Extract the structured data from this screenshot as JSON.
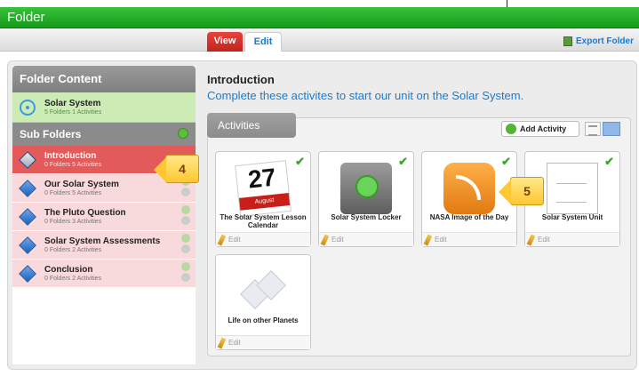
{
  "window": {
    "title": "Folder"
  },
  "tabs": [
    {
      "label": "View"
    },
    {
      "label": "Edit"
    }
  ],
  "export": {
    "label": "Export Folder"
  },
  "sidebar": {
    "header": "Folder Content",
    "root": {
      "title": "Solar System",
      "subtitle": "5 Folders 1 Activities"
    },
    "sub_header": "Sub Folders",
    "items": [
      {
        "title": "Introduction",
        "subtitle": "0 Folders 5 Activities"
      },
      {
        "title": "Our Solar System",
        "subtitle": "0 Folders 5 Activities"
      },
      {
        "title": "The Pluto Question",
        "subtitle": "0 Folders 3 Activities"
      },
      {
        "title": "Solar System Assessments",
        "subtitle": "0 Folders 2 Activities"
      },
      {
        "title": "Conclusion",
        "subtitle": "0 Folders 2 Activities"
      }
    ]
  },
  "callouts": {
    "a": "4",
    "b": "5"
  },
  "main": {
    "title": "Introduction",
    "description": "Complete these activites to start our unit on the Solar System.",
    "activities_tab": "Activities",
    "add_label": "Add Activity",
    "cards": [
      {
        "label": "The Solar System Lesson Calendar",
        "edit": "Edit",
        "icon": "calendar-icon",
        "cal_day": "27",
        "cal_month": "August"
      },
      {
        "label": "Solar System Locker",
        "edit": "Edit",
        "icon": "locker-icon"
      },
      {
        "label": "NASA Image of the Day",
        "edit": "Edit",
        "icon": "rss-icon"
      },
      {
        "label": "Solar System Unit",
        "edit": "Edit",
        "icon": "document-icon"
      },
      {
        "label": "Life on other Planets",
        "edit": "Edit",
        "icon": "shapes-icon"
      }
    ]
  },
  "colors": {
    "brand_green": "#1fa822",
    "active_red": "#e35a5a",
    "link_blue": "#1a7bd0"
  }
}
